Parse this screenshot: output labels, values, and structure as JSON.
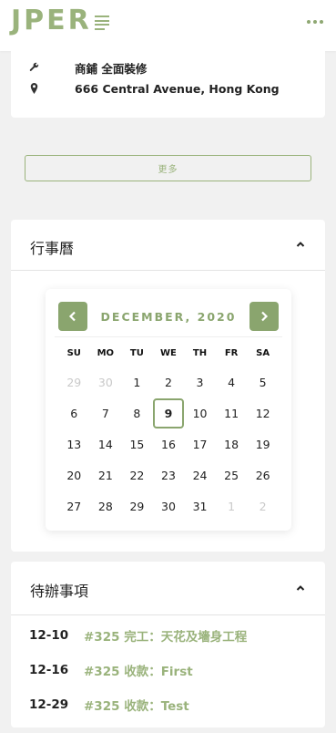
{
  "header": {
    "logo": "JPER"
  },
  "info": {
    "category": "商鋪 全面裝修",
    "address": "666 Central Avenue, Hong Kong"
  },
  "more_button": "更多",
  "calendar_section": {
    "title": "行事曆",
    "month_label": "DECEMBER, 2020",
    "weekdays": [
      "SU",
      "MO",
      "TU",
      "WE",
      "TH",
      "FR",
      "SA"
    ],
    "weeks": [
      [
        "29",
        "30",
        "1",
        "2",
        "3",
        "4",
        "5"
      ],
      [
        "6",
        "7",
        "8",
        "9",
        "10",
        "11",
        "12"
      ],
      [
        "13",
        "14",
        "15",
        "16",
        "17",
        "18",
        "19"
      ],
      [
        "20",
        "21",
        "22",
        "23",
        "24",
        "25",
        "26"
      ],
      [
        "27",
        "28",
        "29",
        "30",
        "31",
        "1",
        "2"
      ]
    ],
    "selected_day": "9"
  },
  "todo_section": {
    "title": "待辦事項",
    "items": [
      {
        "date": "12-10",
        "text": "#325 完工：天花及墻身工程"
      },
      {
        "date": "12-16",
        "text": "#325 收款：First"
      },
      {
        "date": "12-29",
        "text": "#325 收款：Test"
      }
    ]
  },
  "colors": {
    "accent": "#9ab37c",
    "accent_dark": "#8aa56e",
    "background": "#f1f1f1"
  }
}
